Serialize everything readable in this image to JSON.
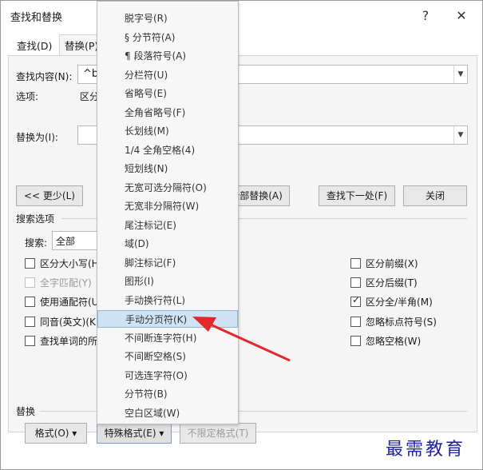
{
  "dialog": {
    "title": "查找和替换",
    "help_label": "?",
    "close_label": "✕"
  },
  "tabs": [
    {
      "label": "查找(D)"
    },
    {
      "label": "替换(P)"
    }
  ],
  "find": {
    "label": "查找内容(N):",
    "value": "^b",
    "options_label": "选项:",
    "options_value": "区分"
  },
  "replace": {
    "label": "替换为(I):",
    "value": ""
  },
  "buttons": {
    "less": "<< 更少(L)",
    "replace_all": "全部替换(A)",
    "find_next": "查找下一处(F)",
    "cancel": "关闭"
  },
  "search_options": {
    "group_label": "搜索选项",
    "search_label": "搜索:",
    "search_value": "全部",
    "left_checks": [
      {
        "label": "区分大小写(H",
        "checked": false,
        "disabled": false
      },
      {
        "label": "全字匹配(Y)",
        "checked": false,
        "disabled": true
      },
      {
        "label": "使用通配符(U",
        "checked": false,
        "disabled": false
      },
      {
        "label": "同音(英文)(K)",
        "checked": false,
        "disabled": false
      },
      {
        "label": "查找单词的所",
        "checked": false,
        "disabled": false
      }
    ],
    "right_checks": [
      {
        "label": "区分前缀(X)",
        "checked": false
      },
      {
        "label": "区分后缀(T)",
        "checked": false
      },
      {
        "label": "区分全/半角(M)",
        "checked": true
      },
      {
        "label": "忽略标点符号(S)",
        "checked": false
      },
      {
        "label": "忽略空格(W)",
        "checked": false
      }
    ]
  },
  "replace_group": {
    "label": "替换",
    "format_btn": "格式(O) ▾",
    "special_btn": "特殊格式(E) ▾",
    "no_format_btn": "不限定格式(T)"
  },
  "special_menu": {
    "items": [
      {
        "label": "脱字号(R)"
      },
      {
        "label": "§ 分节符(A)"
      },
      {
        "label": "¶ 段落符号(A)"
      },
      {
        "label": "分栏符(U)"
      },
      {
        "label": "省略号(E)"
      },
      {
        "label": "全角省略号(F)"
      },
      {
        "label": "长划线(M)"
      },
      {
        "label": "1/4 全角空格(4)"
      },
      {
        "label": "短划线(N)"
      },
      {
        "label": "无宽可选分隔符(O)"
      },
      {
        "label": "无宽非分隔符(W)"
      },
      {
        "label": "尾注标记(E)"
      },
      {
        "label": "域(D)"
      },
      {
        "label": "脚注标记(F)"
      },
      {
        "label": "图形(I)"
      },
      {
        "label": "手动换行符(L)"
      },
      {
        "label": "手动分页符(K)"
      },
      {
        "label": "不间断连字符(H)"
      },
      {
        "label": "不间断空格(S)"
      },
      {
        "label": "可选连字符(O)"
      },
      {
        "label": "分节符(B)"
      },
      {
        "label": "空白区域(W)"
      }
    ],
    "selected_index": 16
  },
  "watermark": "最需教育",
  "colors": {
    "arrow": "#e5262b",
    "selection": "#cfe3f5",
    "watermark": "#1f1fa8"
  }
}
